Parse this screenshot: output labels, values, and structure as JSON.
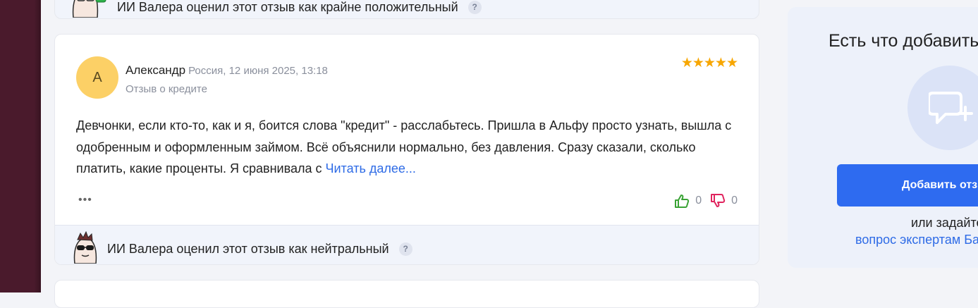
{
  "top_card": {
    "ai_text": "ИИ Валера оценил этот отзыв как крайне положительный",
    "help": "?"
  },
  "review": {
    "avatar_letter": "А",
    "author": "Александр",
    "meta": "Россия, 12 июня 2025, 13:18",
    "subtitle": "Отзыв о кредите",
    "stars": "★★★★★",
    "text": "Девчонки, если кто-то, как и я, боится слова \"кредит\" - расслабьтесь. Пришла в Альфу просто узнать, вышла с одобренным и оформленным займом. Всё объяснили нормально, без давления. Сразу сказали, сколько платить, какие проценты. Я сравнивала с ",
    "read_more": "Читать далее...",
    "more_menu": "•••",
    "likes": "0",
    "dislikes": "0",
    "ai_text": "ИИ Валера оценил этот отзыв как нейтральный",
    "help": "?"
  },
  "side": {
    "title": "Есть что добавить?",
    "button": "Добавить отзыв",
    "or_text": "или задайте",
    "link": "вопрос экспертам Банки.ру"
  },
  "colors": {
    "accent": "#2e6bf0",
    "link": "#2e6be6",
    "star": "#f7a600",
    "like": "#3aa335",
    "dislike": "#e0245e",
    "avatar": "#fcd066"
  }
}
